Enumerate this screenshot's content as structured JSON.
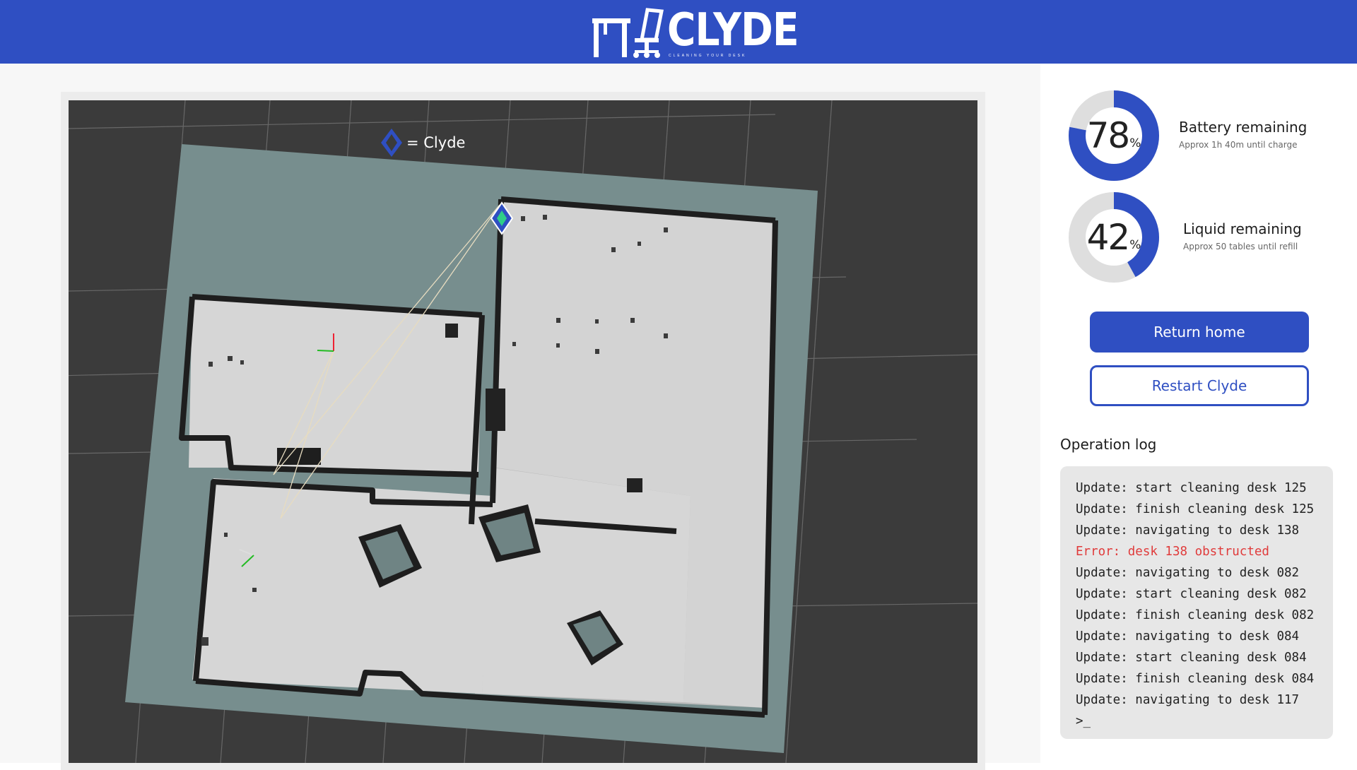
{
  "header": {
    "brand": "CLYDE",
    "tagline": "CLEANING YOUR DESK",
    "logo_icon": "desk-chair-icon"
  },
  "map": {
    "legend_label": "= Clyde",
    "legend_icon": "diamond-marker-icon"
  },
  "battery": {
    "percent": 78,
    "value": "78",
    "unit": "%",
    "title": "Battery remaining",
    "subtitle": "Approx 1h 40m until charge"
  },
  "liquid": {
    "percent": 42,
    "value": "42",
    "unit": "%",
    "title": "Liquid remaining",
    "subtitle": "Approx 50 tables until refill"
  },
  "actions": {
    "return_home": "Return home",
    "restart": "Restart Clyde"
  },
  "log": {
    "title": "Operation log",
    "lines": [
      {
        "text": "Update: start cleaning desk 125",
        "type": "update"
      },
      {
        "text": "Update: finish cleaning desk 125",
        "type": "update"
      },
      {
        "text": "Update: navigating to desk 138",
        "type": "update"
      },
      {
        "text": "Error: desk 138 obstructed",
        "type": "error"
      },
      {
        "text": "Update: navigating to desk 082",
        "type": "update"
      },
      {
        "text": "Update: start cleaning desk 082",
        "type": "update"
      },
      {
        "text": "Update: finish cleaning desk 082",
        "type": "update"
      },
      {
        "text": "Update: navigating to desk 084",
        "type": "update"
      },
      {
        "text": "Update: start cleaning desk 084",
        "type": "update"
      },
      {
        "text": "Update: finish cleaning desk 084",
        "type": "update"
      },
      {
        "text": "Update: navigating to desk 117",
        "type": "update"
      },
      {
        "text": ">_",
        "type": "prompt"
      }
    ]
  },
  "colors": {
    "brand": "#2f4fc2",
    "track": "#dedede",
    "error": "#e03b3b"
  }
}
